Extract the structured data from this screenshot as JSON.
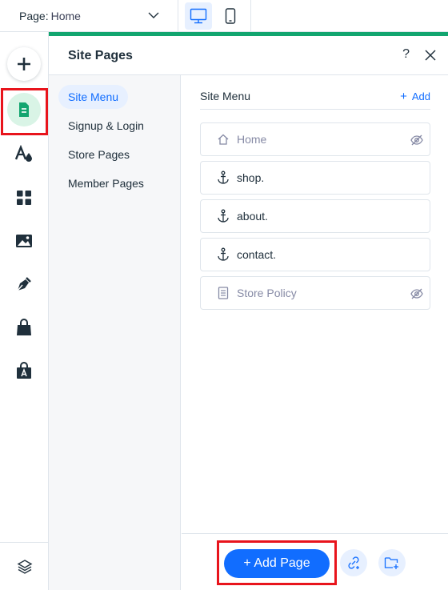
{
  "topbar": {
    "page_label": "Page:",
    "page_value": "Home",
    "devices": [
      {
        "name": "desktop",
        "active": true
      },
      {
        "name": "mobile",
        "active": false
      }
    ]
  },
  "rail": {
    "items": [
      "add-icon",
      "pages-icon",
      "design-icon",
      "apps-icon",
      "media-icon",
      "blog-icon",
      "store-icon",
      "app-market-icon",
      "layers-icon"
    ]
  },
  "panel": {
    "title": "Site Pages",
    "help": "?",
    "nav": [
      {
        "label": "Site Menu",
        "active": true
      },
      {
        "label": "Signup & Login",
        "active": false
      },
      {
        "label": "Store Pages",
        "active": false
      },
      {
        "label": "Member Pages",
        "active": false
      }
    ],
    "section_title": "Site Menu",
    "add_label": "Add",
    "pages": [
      {
        "name": "Home",
        "icon": "home-icon",
        "hidden": true
      },
      {
        "name": "shop.",
        "icon": "anchor-icon",
        "hidden": false
      },
      {
        "name": "about.",
        "icon": "anchor-icon",
        "hidden": false
      },
      {
        "name": "contact.",
        "icon": "anchor-icon",
        "hidden": false
      },
      {
        "name": "Store Policy",
        "icon": "document-icon",
        "hidden": true
      }
    ],
    "add_page_label": "+ Add Page"
  },
  "colors": {
    "accent_green": "#12a56f",
    "primary_blue": "#116dff",
    "highlight_red": "#e8141c"
  }
}
